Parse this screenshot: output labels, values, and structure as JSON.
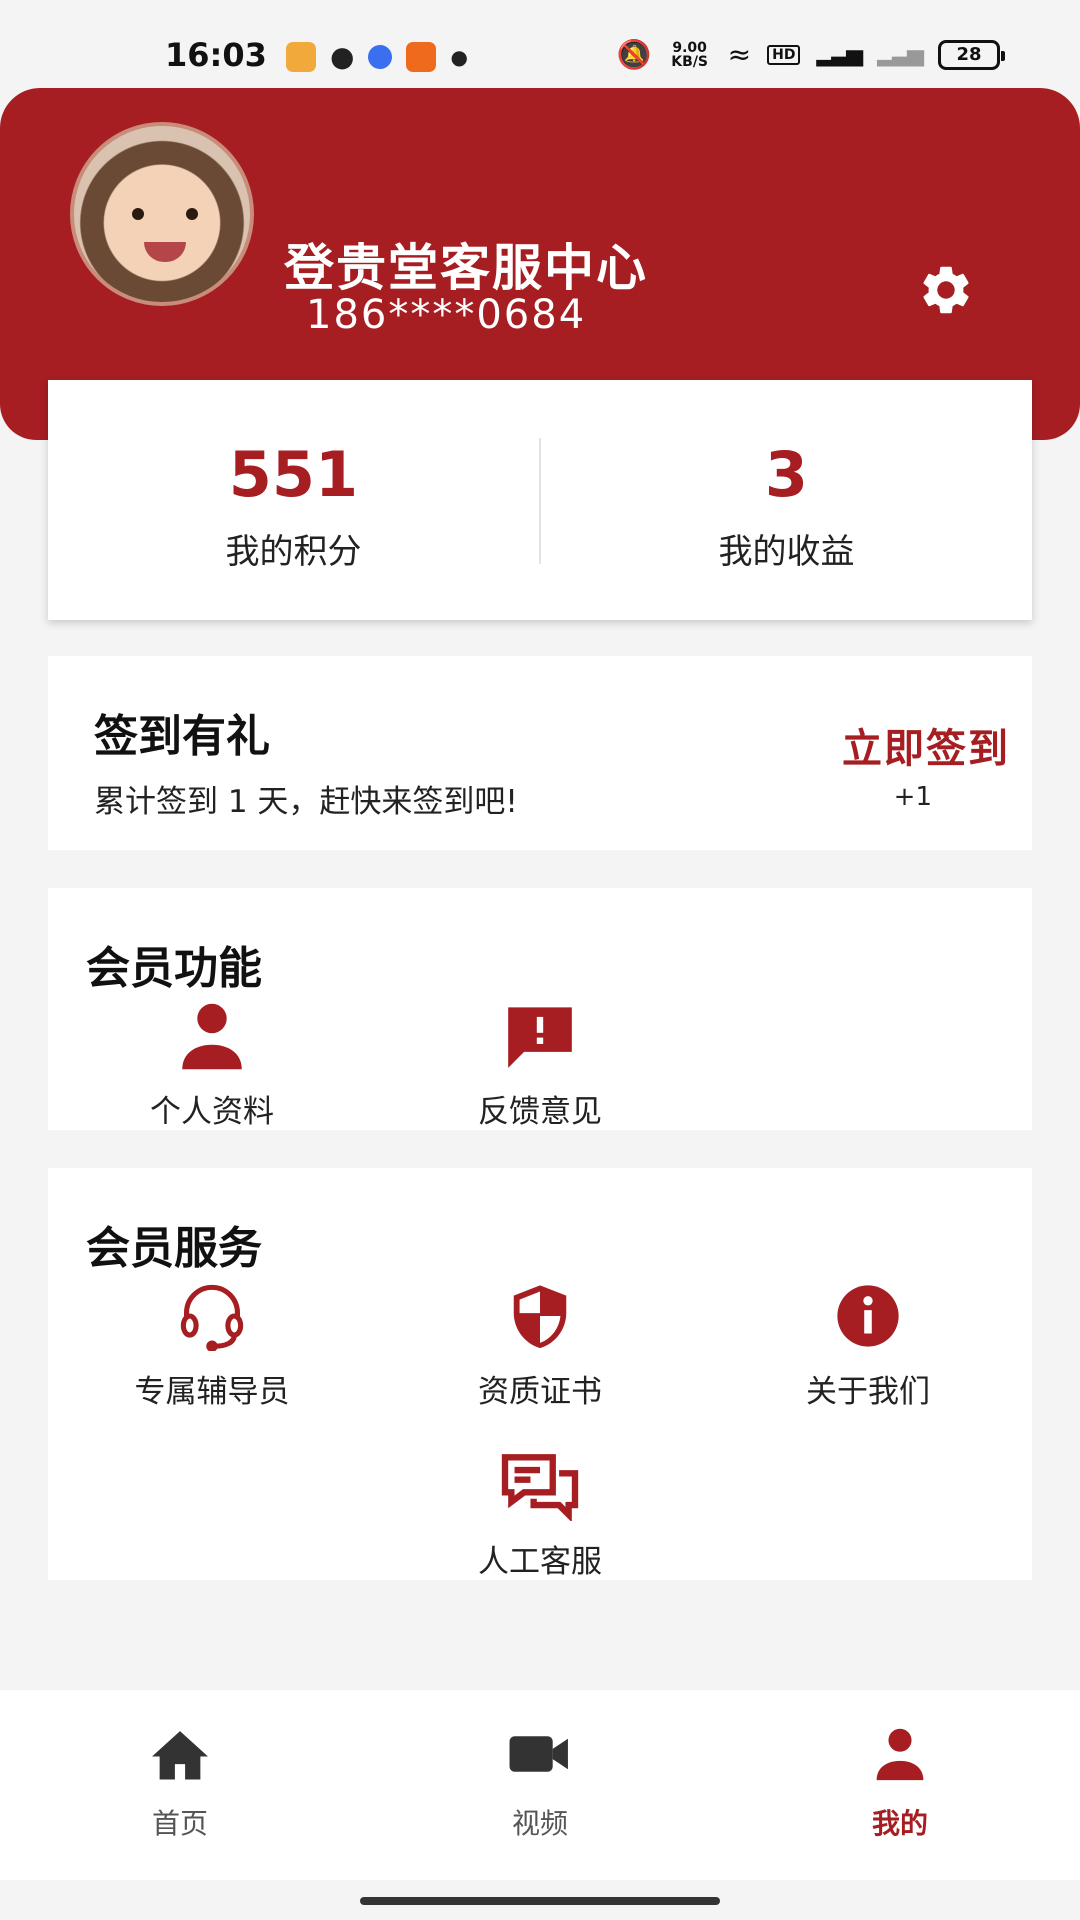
{
  "status_bar": {
    "time": "16:03",
    "speed": "9.00 KB/S",
    "battery": "28"
  },
  "profile": {
    "name": "登贵堂客服中心",
    "phone": "186****0684",
    "settings_icon": "gear-icon"
  },
  "stats": {
    "points_value": "551",
    "points_label": "我的积分",
    "earnings_value": "3",
    "earnings_label": "我的收益"
  },
  "checkin": {
    "title": "签到有礼",
    "desc": "累计签到 1 天，赶快来签到吧!",
    "button": "立即签到",
    "bonus": "+1"
  },
  "member_functions": {
    "title": "会员功能",
    "items": [
      {
        "label": "个人资料",
        "icon": "person-icon"
      },
      {
        "label": "反馈意见",
        "icon": "feedback-icon"
      }
    ]
  },
  "member_services": {
    "title": "会员服务",
    "items": [
      {
        "label": "专属辅导员",
        "icon": "headset-icon"
      },
      {
        "label": "资质证书",
        "icon": "shield-icon"
      },
      {
        "label": "关于我们",
        "icon": "info-icon"
      },
      {
        "label": "人工客服",
        "icon": "chat-icon"
      }
    ]
  },
  "bottom_nav": {
    "items": [
      {
        "label": "首页",
        "icon": "home-icon",
        "active": false
      },
      {
        "label": "视频",
        "icon": "video-icon",
        "active": false
      },
      {
        "label": "我的",
        "icon": "person-icon",
        "active": true
      }
    ]
  },
  "colors": {
    "accent": "#a61e22",
    "background": "#f4f4f4"
  }
}
